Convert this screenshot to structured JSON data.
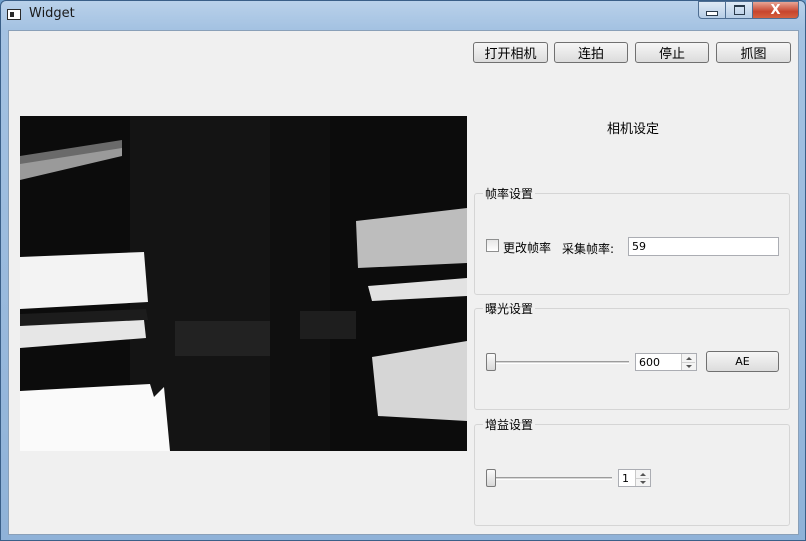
{
  "window": {
    "title": "Widget",
    "controls": {
      "minimize_icon": "minimize-icon",
      "maximize_icon": "maximize-icon",
      "close_glyph": "X"
    }
  },
  "toolbar": {
    "open_camera_label": "打开相机",
    "burst_label": "连拍",
    "stop_label": "停止",
    "capture_label": "抓图"
  },
  "camera_settings": {
    "title": "相机设定",
    "frame_rate": {
      "group_title": "帧率设置",
      "change_checkbox_label": "更改帧率",
      "change_checkbox_checked": false,
      "capture_rate_label": "采集帧率:",
      "capture_rate_value": "59"
    },
    "exposure": {
      "group_title": "曝光设置",
      "slider_level": 0,
      "spin_value": "600",
      "ae_button_label": "AE"
    },
    "gain": {
      "group_title": "增益设置",
      "slider_level": 0,
      "spin_value": "1"
    }
  },
  "camera_view": {
    "content": "live-camera-feed"
  }
}
